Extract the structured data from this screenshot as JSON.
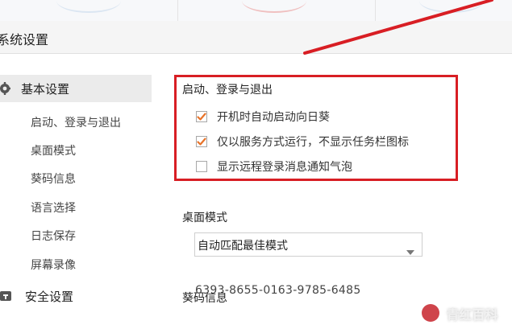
{
  "dialog": {
    "title": "系统设置"
  },
  "sidebar": {
    "sections": [
      {
        "label": "基本设置",
        "icon": "gear-icon",
        "items": [
          "启动、登录与退出",
          "桌面模式",
          "葵码信息",
          "语言选择",
          "日志保存",
          "屏幕录像"
        ]
      },
      {
        "label": "安全设置",
        "icon": "shield-icon",
        "items": []
      }
    ]
  },
  "content": {
    "startup": {
      "title": "启动、登录与退出",
      "options": [
        {
          "label": "开机时自动启动向日葵",
          "checked": true
        },
        {
          "label": "仅以服务方式运行，不显示任务栏图标",
          "checked": true
        },
        {
          "label": "显示远程登录消息通知气泡",
          "checked": false
        }
      ]
    },
    "desktop_mode": {
      "title": "桌面模式",
      "selected": "自动匹配最佳模式"
    },
    "kuima": {
      "title": "葵码信息",
      "code": "6393-8655-0163-9785-6485"
    }
  },
  "watermark": {
    "text": "青红百科"
  },
  "colors": {
    "accent_check": "#e8732a",
    "highlight_box": "#d81e24"
  }
}
